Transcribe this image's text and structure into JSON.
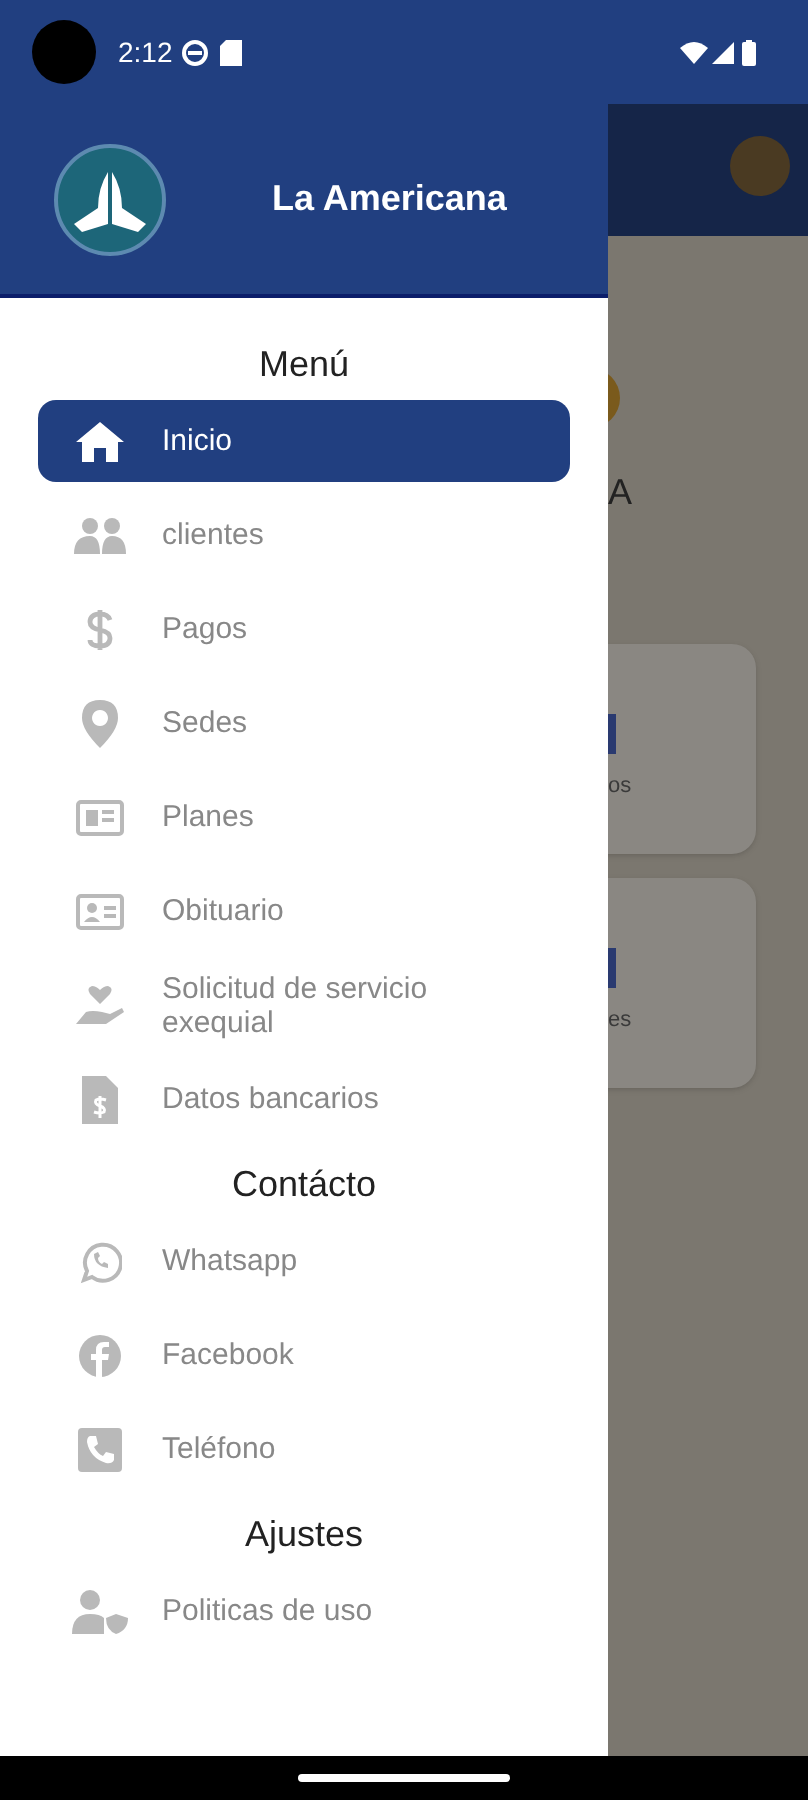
{
  "status_bar": {
    "time": "2:12"
  },
  "drawer": {
    "title": "La Americana",
    "entries": [
      {
        "kind": "header",
        "label": "Menú"
      },
      {
        "kind": "item",
        "label": "Inicio",
        "selected": true
      },
      {
        "kind": "item",
        "label": "clientes",
        "selected": false
      },
      {
        "kind": "item",
        "label": "Pagos",
        "selected": false
      },
      {
        "kind": "item",
        "label": "Sedes",
        "selected": false
      },
      {
        "kind": "item",
        "label": "Planes",
        "selected": false
      },
      {
        "kind": "item",
        "label": "Obituario",
        "selected": false
      },
      {
        "kind": "item",
        "label": "Solicitud de servicio exequial",
        "selected": false
      },
      {
        "kind": "item",
        "label": "Datos bancarios",
        "selected": false
      },
      {
        "kind": "header",
        "label": "Contácto"
      },
      {
        "kind": "item",
        "label": "Whatsapp",
        "selected": false
      },
      {
        "kind": "item",
        "label": "Facebook",
        "selected": false
      },
      {
        "kind": "item",
        "label": "Teléfono",
        "selected": false
      },
      {
        "kind": "header",
        "label": "Ajustes"
      },
      {
        "kind": "item",
        "label": "Politicas de uso",
        "selected": false
      }
    ]
  },
  "background": {
    "name_fragment": "A",
    "cards": [
      {
        "label_fragment": "os"
      },
      {
        "label_fragment": "es"
      }
    ]
  }
}
